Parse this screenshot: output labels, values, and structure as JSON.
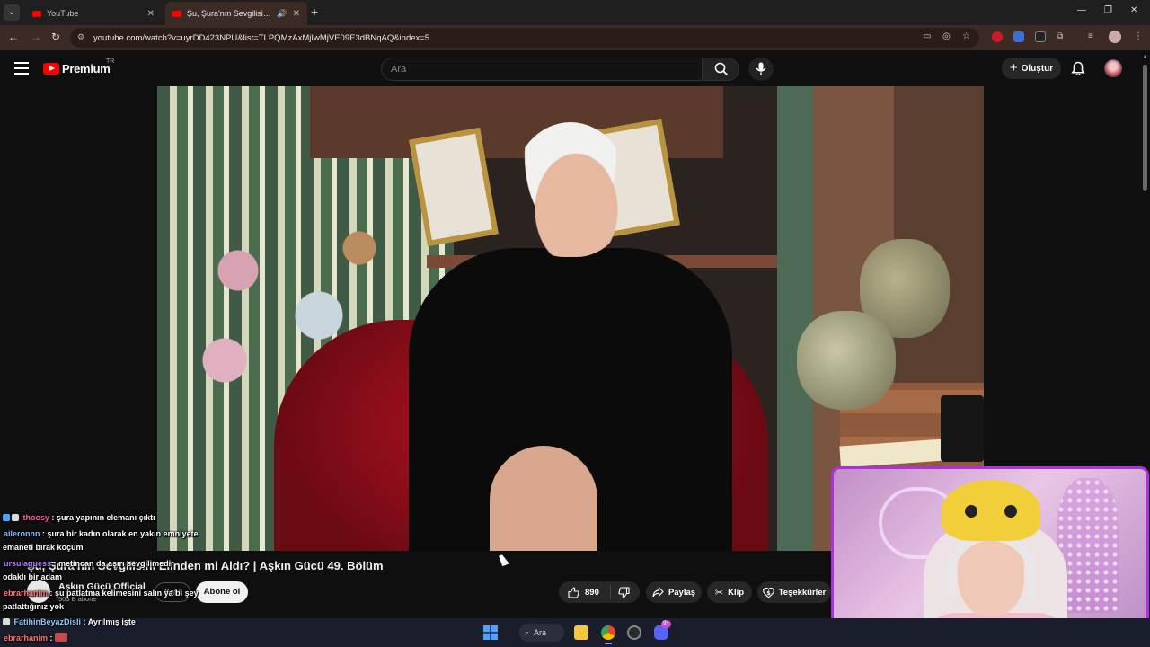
{
  "browser": {
    "tabs": [
      {
        "title": "YouTube",
        "active": false
      },
      {
        "title": "Şu, Şura'nın Sevgilisini Elinden",
        "active": true
      }
    ],
    "url": "youtube.com/watch?v=uyrDD423NPU&list=TLPQMzAxMjIwMjVE09E3dBNqAQ&index=5"
  },
  "masthead": {
    "brand": "Premium",
    "region": "TR",
    "search_placeholder": "Ara",
    "create_label": "Oluştur"
  },
  "video": {
    "title": "Şu, Şura'nın Sevgilisini Elinden mi Aldı? | Aşkın Gücü 49. Bölüm",
    "channel_name": "Aşkın Gücü Official",
    "channel_subs": "503 B abone",
    "join_label": "Katıl",
    "subscribe_label": "Abone ol",
    "likes": "890",
    "share_label": "Paylaş",
    "clip_label": "Klip",
    "thanks_label": "Teşekkürler"
  },
  "chat": [
    {
      "user": "thoosy",
      "color": "#ff5ea8",
      "text": ": şura yapının elemanı çıktı"
    },
    {
      "user": "aileronnn",
      "color": "#7fb8ff",
      "text": ": şura bir kadın olarak en yakın emniyete"
    },
    {
      "user": "",
      "color": "#ffffff",
      "text": "emaneti bırak koçum"
    },
    {
      "user": "ursulaguess",
      "color": "#b27cff",
      "text": ": metincan da aşırı sevgilimedir"
    },
    {
      "user": "",
      "color": "#ffffff",
      "text": "odaklı bir adam"
    },
    {
      "user": "ebrarhanim",
      "color": "#ff7777",
      "text": ": şu patlatma kelimesini salın ya bi şey"
    },
    {
      "user": "",
      "color": "#ffffff",
      "text": "patlattığınız yok"
    },
    {
      "user": "FatihinBeyazDisli",
      "color": "#8ec9ff",
      "text": ": Ayrılmış işte"
    },
    {
      "user": "ebrarhanim",
      "color": "#ff7777",
      "text": ":"
    }
  ],
  "taskbar": {
    "search_label": "Ara",
    "notification_count": "9+"
  },
  "colors": {
    "youtube_red": "#ff0000",
    "tab_active_bg": "#3c2a25",
    "cam_border": "#b02ee0"
  }
}
